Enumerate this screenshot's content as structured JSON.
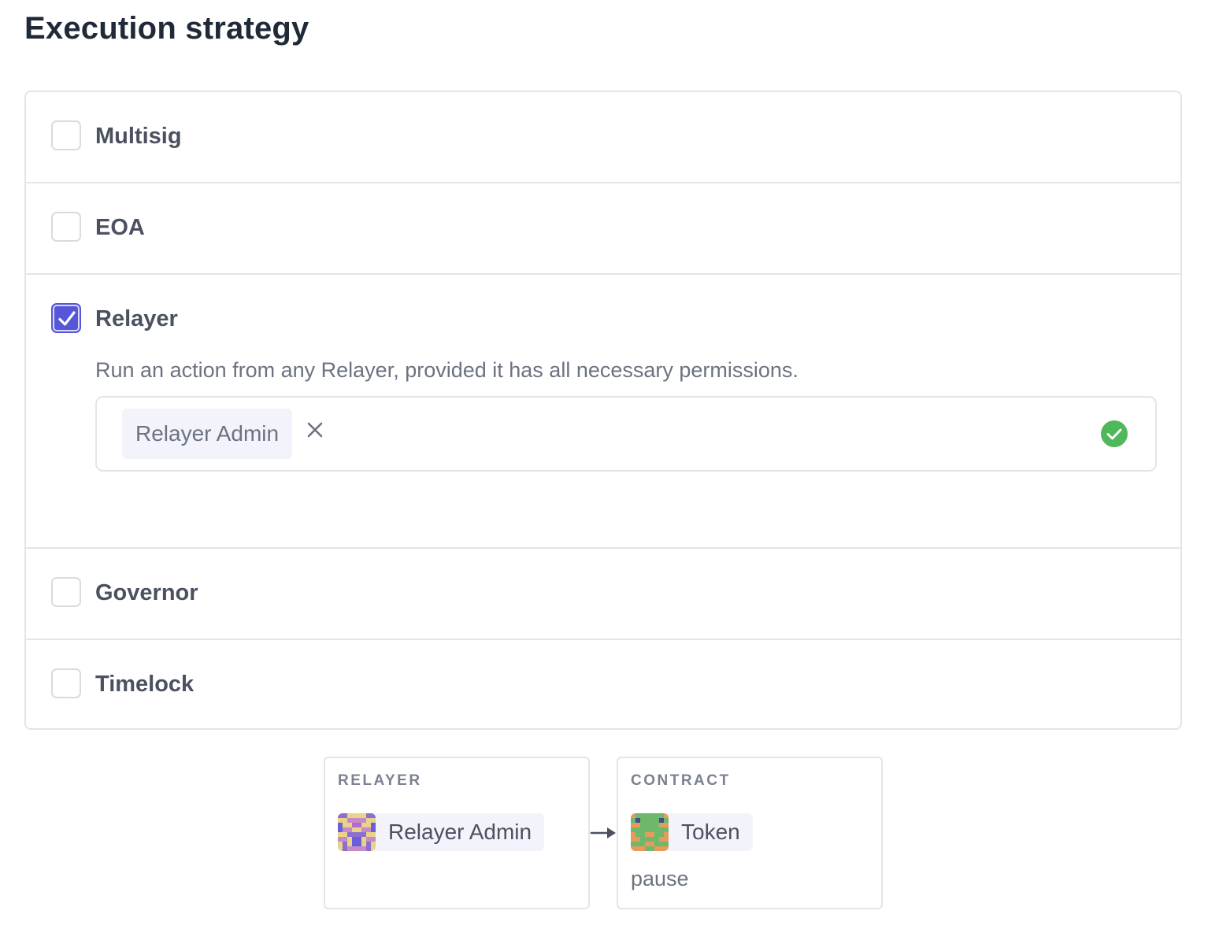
{
  "page": {
    "title": "Execution strategy"
  },
  "options": [
    {
      "label": "Multisig",
      "checked": false
    },
    {
      "label": "EOA",
      "checked": false
    },
    {
      "label": "Relayer",
      "checked": true,
      "description": "Run an action from any Relayer, provided it has all necessary permissions.",
      "selected_relayer": "Relayer Admin"
    },
    {
      "label": "Governor",
      "checked": false
    },
    {
      "label": "Timelock",
      "checked": false
    }
  ],
  "flow": {
    "relayer": {
      "heading": "RELAYER",
      "name": "Relayer Admin"
    },
    "contract": {
      "heading": "CONTRACT",
      "name": "Token",
      "method": "pause"
    }
  },
  "colors": {
    "accent": "#5656d8",
    "valid": "#4fb85b",
    "border": "#e2e5ea"
  },
  "icons": {
    "check": "checkmark-icon",
    "remove": "close-icon",
    "valid": "check-circle-icon",
    "arrow": "arrow-right-icon"
  }
}
